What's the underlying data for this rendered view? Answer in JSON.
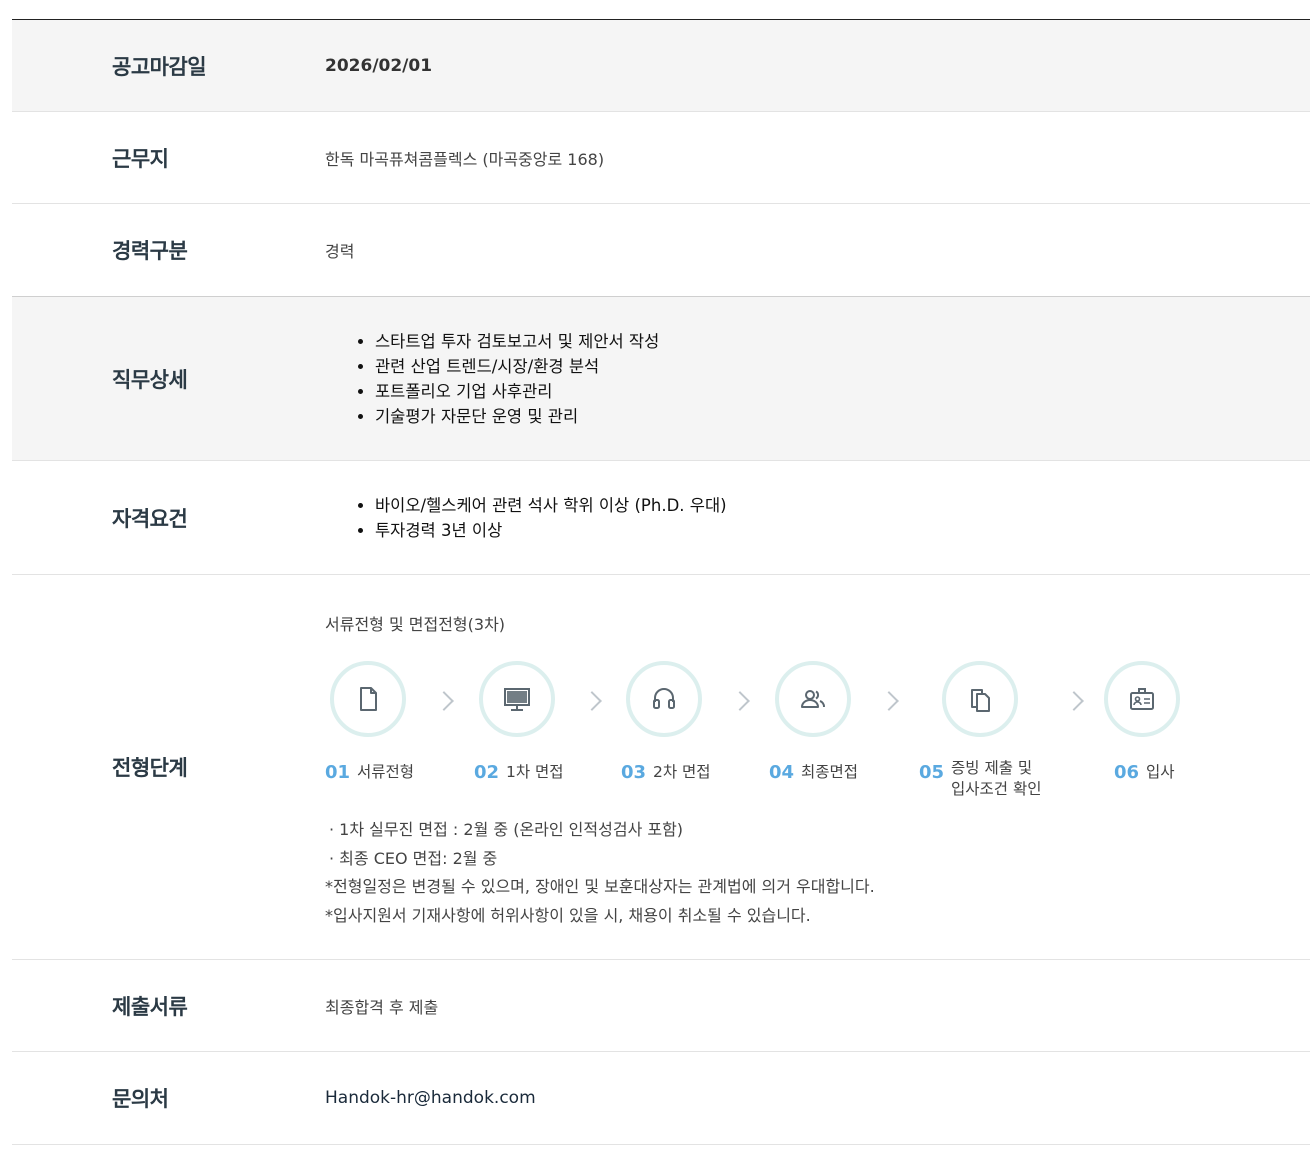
{
  "rows": {
    "deadline": {
      "label": "공고마감일",
      "value": "2026/02/01"
    },
    "location": {
      "label": "근무지",
      "value": "한독 마곡퓨쳐콤플렉스 (마곡중앙로 168)"
    },
    "career": {
      "label": "경력구분",
      "value": "경력"
    },
    "duties": {
      "label": "직무상세",
      "items": [
        "스타트업 투자 검토보고서 및 제안서 작성",
        "관련 산업 트렌드/시장/환경 분석",
        "포트폴리오 기업 사후관리",
        "기술평가 자문단 운영 및 관리"
      ]
    },
    "requirements": {
      "label": "자격요건",
      "items": [
        "바이오/헬스케어 관련 석사 학위 이상 (Ph.D. 우대)",
        "투자경력 3년 이상"
      ]
    },
    "process": {
      "label": "전형단계",
      "title": "서류전형 및 면접전형(3차)",
      "steps": [
        {
          "num": "01",
          "label": "서류전형",
          "icon": "document-icon"
        },
        {
          "num": "02",
          "label": "1차 면접",
          "icon": "monitor-icon"
        },
        {
          "num": "03",
          "label": "2차 면접",
          "icon": "headset-icon"
        },
        {
          "num": "04",
          "label": "최종면접",
          "icon": "people-icon"
        },
        {
          "num": "05",
          "label_line1": "증빙 제출 및",
          "label_line2": "입사조건 확인",
          "icon": "copy-icon"
        },
        {
          "num": "06",
          "label": "입사",
          "icon": "id-badge-icon"
        }
      ],
      "notes": [
        "·  1차 실무진 면접 : 2월 중 (온라인 인적성검사 포함)",
        "·  최종 CEO 면접: 2월 중",
        "*전형일정은 변경될 수 있으며, 장애인 및 보훈대상자는 관계법에 의거 우대합니다.",
        "*입사지원서 기재사항에 허위사항이 있을 시, 채용이 취소될 수 있습니다."
      ]
    },
    "documents": {
      "label": "제출서류",
      "value": "최종합격 후 제출"
    },
    "contact": {
      "label": "문의처",
      "value": "Handok-hr@handok.com"
    }
  },
  "colors": {
    "accent": "#5aa9e0",
    "circle_border": "#dcefee",
    "icon_stroke": "#5b6770",
    "label": "#2b3a45"
  }
}
